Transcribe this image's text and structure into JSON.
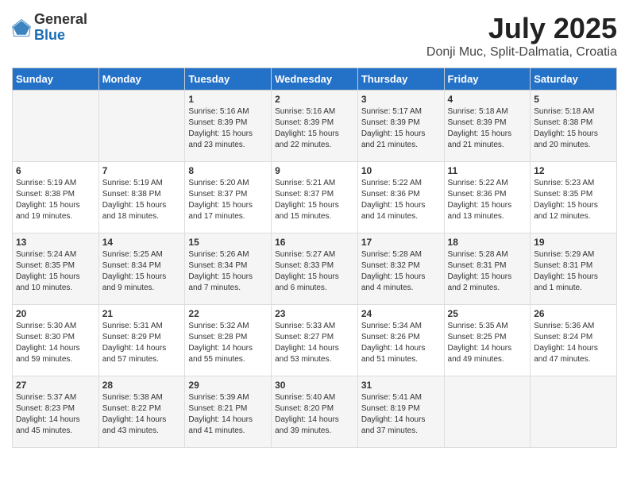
{
  "logo": {
    "general": "General",
    "blue": "Blue"
  },
  "title": "July 2025",
  "subtitle": "Donji Muc, Split-Dalmatia, Croatia",
  "days_of_week": [
    "Sunday",
    "Monday",
    "Tuesday",
    "Wednesday",
    "Thursday",
    "Friday",
    "Saturday"
  ],
  "weeks": [
    [
      {
        "day": "",
        "sunrise": "",
        "sunset": "",
        "daylight": ""
      },
      {
        "day": "",
        "sunrise": "",
        "sunset": "",
        "daylight": ""
      },
      {
        "day": "1",
        "sunrise": "Sunrise: 5:16 AM",
        "sunset": "Sunset: 8:39 PM",
        "daylight": "Daylight: 15 hours and 23 minutes."
      },
      {
        "day": "2",
        "sunrise": "Sunrise: 5:16 AM",
        "sunset": "Sunset: 8:39 PM",
        "daylight": "Daylight: 15 hours and 22 minutes."
      },
      {
        "day": "3",
        "sunrise": "Sunrise: 5:17 AM",
        "sunset": "Sunset: 8:39 PM",
        "daylight": "Daylight: 15 hours and 21 minutes."
      },
      {
        "day": "4",
        "sunrise": "Sunrise: 5:18 AM",
        "sunset": "Sunset: 8:39 PM",
        "daylight": "Daylight: 15 hours and 21 minutes."
      },
      {
        "day": "5",
        "sunrise": "Sunrise: 5:18 AM",
        "sunset": "Sunset: 8:38 PM",
        "daylight": "Daylight: 15 hours and 20 minutes."
      }
    ],
    [
      {
        "day": "6",
        "sunrise": "Sunrise: 5:19 AM",
        "sunset": "Sunset: 8:38 PM",
        "daylight": "Daylight: 15 hours and 19 minutes."
      },
      {
        "day": "7",
        "sunrise": "Sunrise: 5:19 AM",
        "sunset": "Sunset: 8:38 PM",
        "daylight": "Daylight: 15 hours and 18 minutes."
      },
      {
        "day": "8",
        "sunrise": "Sunrise: 5:20 AM",
        "sunset": "Sunset: 8:37 PM",
        "daylight": "Daylight: 15 hours and 17 minutes."
      },
      {
        "day": "9",
        "sunrise": "Sunrise: 5:21 AM",
        "sunset": "Sunset: 8:37 PM",
        "daylight": "Daylight: 15 hours and 15 minutes."
      },
      {
        "day": "10",
        "sunrise": "Sunrise: 5:22 AM",
        "sunset": "Sunset: 8:36 PM",
        "daylight": "Daylight: 15 hours and 14 minutes."
      },
      {
        "day": "11",
        "sunrise": "Sunrise: 5:22 AM",
        "sunset": "Sunset: 8:36 PM",
        "daylight": "Daylight: 15 hours and 13 minutes."
      },
      {
        "day": "12",
        "sunrise": "Sunrise: 5:23 AM",
        "sunset": "Sunset: 8:35 PM",
        "daylight": "Daylight: 15 hours and 12 minutes."
      }
    ],
    [
      {
        "day": "13",
        "sunrise": "Sunrise: 5:24 AM",
        "sunset": "Sunset: 8:35 PM",
        "daylight": "Daylight: 15 hours and 10 minutes."
      },
      {
        "day": "14",
        "sunrise": "Sunrise: 5:25 AM",
        "sunset": "Sunset: 8:34 PM",
        "daylight": "Daylight: 15 hours and 9 minutes."
      },
      {
        "day": "15",
        "sunrise": "Sunrise: 5:26 AM",
        "sunset": "Sunset: 8:34 PM",
        "daylight": "Daylight: 15 hours and 7 minutes."
      },
      {
        "day": "16",
        "sunrise": "Sunrise: 5:27 AM",
        "sunset": "Sunset: 8:33 PM",
        "daylight": "Daylight: 15 hours and 6 minutes."
      },
      {
        "day": "17",
        "sunrise": "Sunrise: 5:28 AM",
        "sunset": "Sunset: 8:32 PM",
        "daylight": "Daylight: 15 hours and 4 minutes."
      },
      {
        "day": "18",
        "sunrise": "Sunrise: 5:28 AM",
        "sunset": "Sunset: 8:31 PM",
        "daylight": "Daylight: 15 hours and 2 minutes."
      },
      {
        "day": "19",
        "sunrise": "Sunrise: 5:29 AM",
        "sunset": "Sunset: 8:31 PM",
        "daylight": "Daylight: 15 hours and 1 minute."
      }
    ],
    [
      {
        "day": "20",
        "sunrise": "Sunrise: 5:30 AM",
        "sunset": "Sunset: 8:30 PM",
        "daylight": "Daylight: 14 hours and 59 minutes."
      },
      {
        "day": "21",
        "sunrise": "Sunrise: 5:31 AM",
        "sunset": "Sunset: 8:29 PM",
        "daylight": "Daylight: 14 hours and 57 minutes."
      },
      {
        "day": "22",
        "sunrise": "Sunrise: 5:32 AM",
        "sunset": "Sunset: 8:28 PM",
        "daylight": "Daylight: 14 hours and 55 minutes."
      },
      {
        "day": "23",
        "sunrise": "Sunrise: 5:33 AM",
        "sunset": "Sunset: 8:27 PM",
        "daylight": "Daylight: 14 hours and 53 minutes."
      },
      {
        "day": "24",
        "sunrise": "Sunrise: 5:34 AM",
        "sunset": "Sunset: 8:26 PM",
        "daylight": "Daylight: 14 hours and 51 minutes."
      },
      {
        "day": "25",
        "sunrise": "Sunrise: 5:35 AM",
        "sunset": "Sunset: 8:25 PM",
        "daylight": "Daylight: 14 hours and 49 minutes."
      },
      {
        "day": "26",
        "sunrise": "Sunrise: 5:36 AM",
        "sunset": "Sunset: 8:24 PM",
        "daylight": "Daylight: 14 hours and 47 minutes."
      }
    ],
    [
      {
        "day": "27",
        "sunrise": "Sunrise: 5:37 AM",
        "sunset": "Sunset: 8:23 PM",
        "daylight": "Daylight: 14 hours and 45 minutes."
      },
      {
        "day": "28",
        "sunrise": "Sunrise: 5:38 AM",
        "sunset": "Sunset: 8:22 PM",
        "daylight": "Daylight: 14 hours and 43 minutes."
      },
      {
        "day": "29",
        "sunrise": "Sunrise: 5:39 AM",
        "sunset": "Sunset: 8:21 PM",
        "daylight": "Daylight: 14 hours and 41 minutes."
      },
      {
        "day": "30",
        "sunrise": "Sunrise: 5:40 AM",
        "sunset": "Sunset: 8:20 PM",
        "daylight": "Daylight: 14 hours and 39 minutes."
      },
      {
        "day": "31",
        "sunrise": "Sunrise: 5:41 AM",
        "sunset": "Sunset: 8:19 PM",
        "daylight": "Daylight: 14 hours and 37 minutes."
      },
      {
        "day": "",
        "sunrise": "",
        "sunset": "",
        "daylight": ""
      },
      {
        "day": "",
        "sunrise": "",
        "sunset": "",
        "daylight": ""
      }
    ]
  ]
}
